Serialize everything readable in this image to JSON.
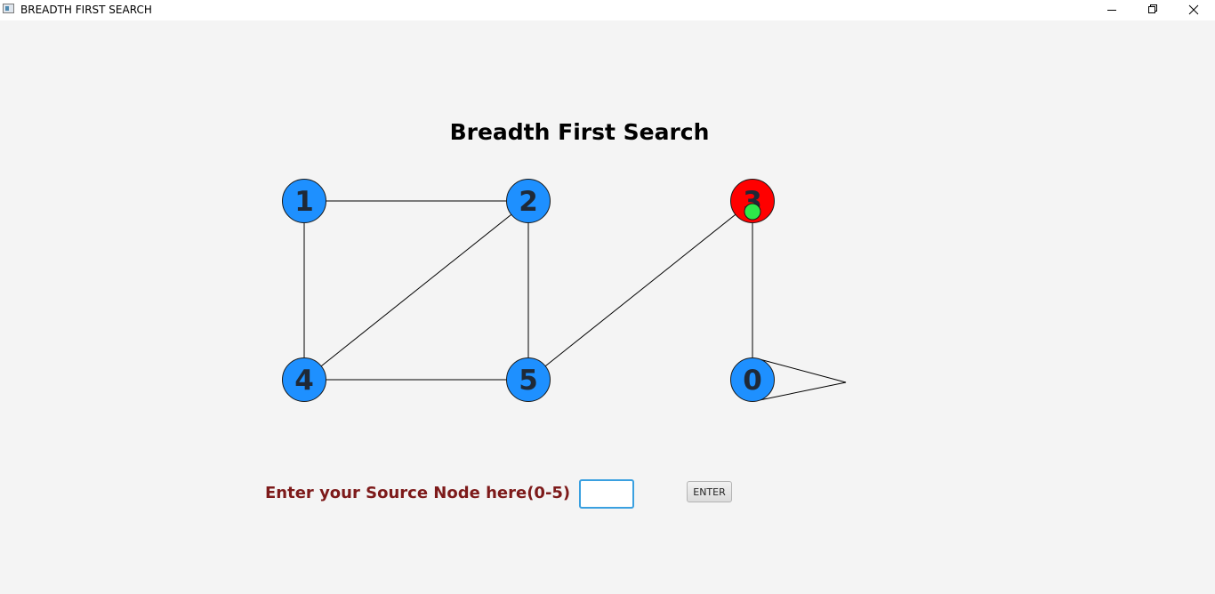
{
  "window": {
    "title": "BREADTH FIRST SEARCH",
    "controls": [
      "minimize-icon",
      "restore-icon",
      "close-icon"
    ]
  },
  "heading": "Breadth First Search",
  "graph": {
    "nodes": [
      {
        "id": "1",
        "label": "1",
        "state": "unvisited",
        "color": "#1e90ff"
      },
      {
        "id": "2",
        "label": "2",
        "state": "unvisited",
        "color": "#1e90ff"
      },
      {
        "id": "3",
        "label": "3",
        "state": "current",
        "color": "#ff0000",
        "marker_color": "#2ee84a"
      },
      {
        "id": "4",
        "label": "4",
        "state": "unvisited",
        "color": "#1e90ff"
      },
      {
        "id": "5",
        "label": "5",
        "state": "unvisited",
        "color": "#1e90ff"
      },
      {
        "id": "0",
        "label": "0",
        "state": "unvisited",
        "color": "#1e90ff"
      }
    ],
    "edges": [
      [
        "1",
        "2"
      ],
      [
        "1",
        "4"
      ],
      [
        "2",
        "4"
      ],
      [
        "2",
        "5"
      ],
      [
        "4",
        "5"
      ],
      [
        "5",
        "3"
      ],
      [
        "3",
        "0"
      ],
      [
        "0",
        "0"
      ]
    ]
  },
  "form": {
    "label": "Enter your Source Node here(0-5)",
    "input_value": "",
    "button_label": "ENTER"
  },
  "colors": {
    "node_default": "#1e90ff",
    "node_current": "#ff0000",
    "marker": "#2ee84a",
    "label_color": "#7d1a1a",
    "input_focus_border": "#3aa0e0"
  }
}
